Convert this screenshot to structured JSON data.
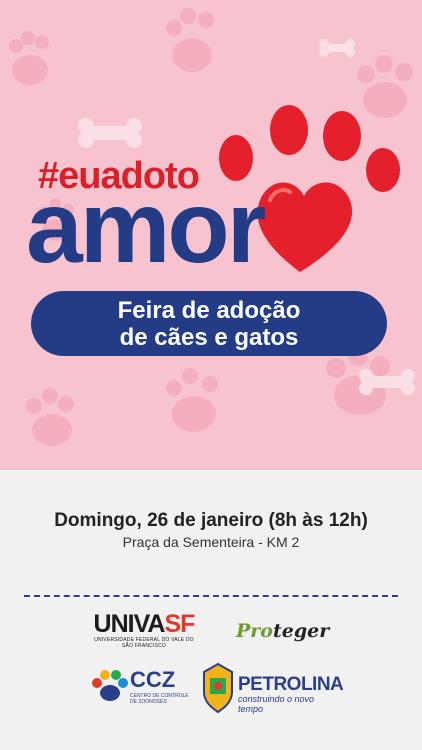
{
  "poster": {
    "hashtag": "#euadoto",
    "headline": "amor",
    "banner_line1": "Feira de adoção",
    "banner_line2": "de cães e gatos"
  },
  "event": {
    "date": "Domingo, 26 de janeiro (8h às 12h)",
    "place": "Praça da Sementeira - KM 2"
  },
  "logos": {
    "univasf": {
      "name_left": "UNIVA",
      "name_right": "SF",
      "tagline": "UNIVERSIDADE FEDERAL DO VALE DO SÃO FRANCISCO"
    },
    "proteger": {
      "name_left": "Pro",
      "name_right": "teger"
    },
    "ccz": {
      "name": "CCZ",
      "tagline_1": "CENTRO DE CONTROLE",
      "tagline_2": "DE ZOONOSES"
    },
    "petrolina": {
      "name": "PETROLINA",
      "tagline": "construindo o novo tempo"
    }
  },
  "colors": {
    "hero_background": "#f7c3cf",
    "brand_blue": "#233c85",
    "brand_red": "#d9212b"
  }
}
